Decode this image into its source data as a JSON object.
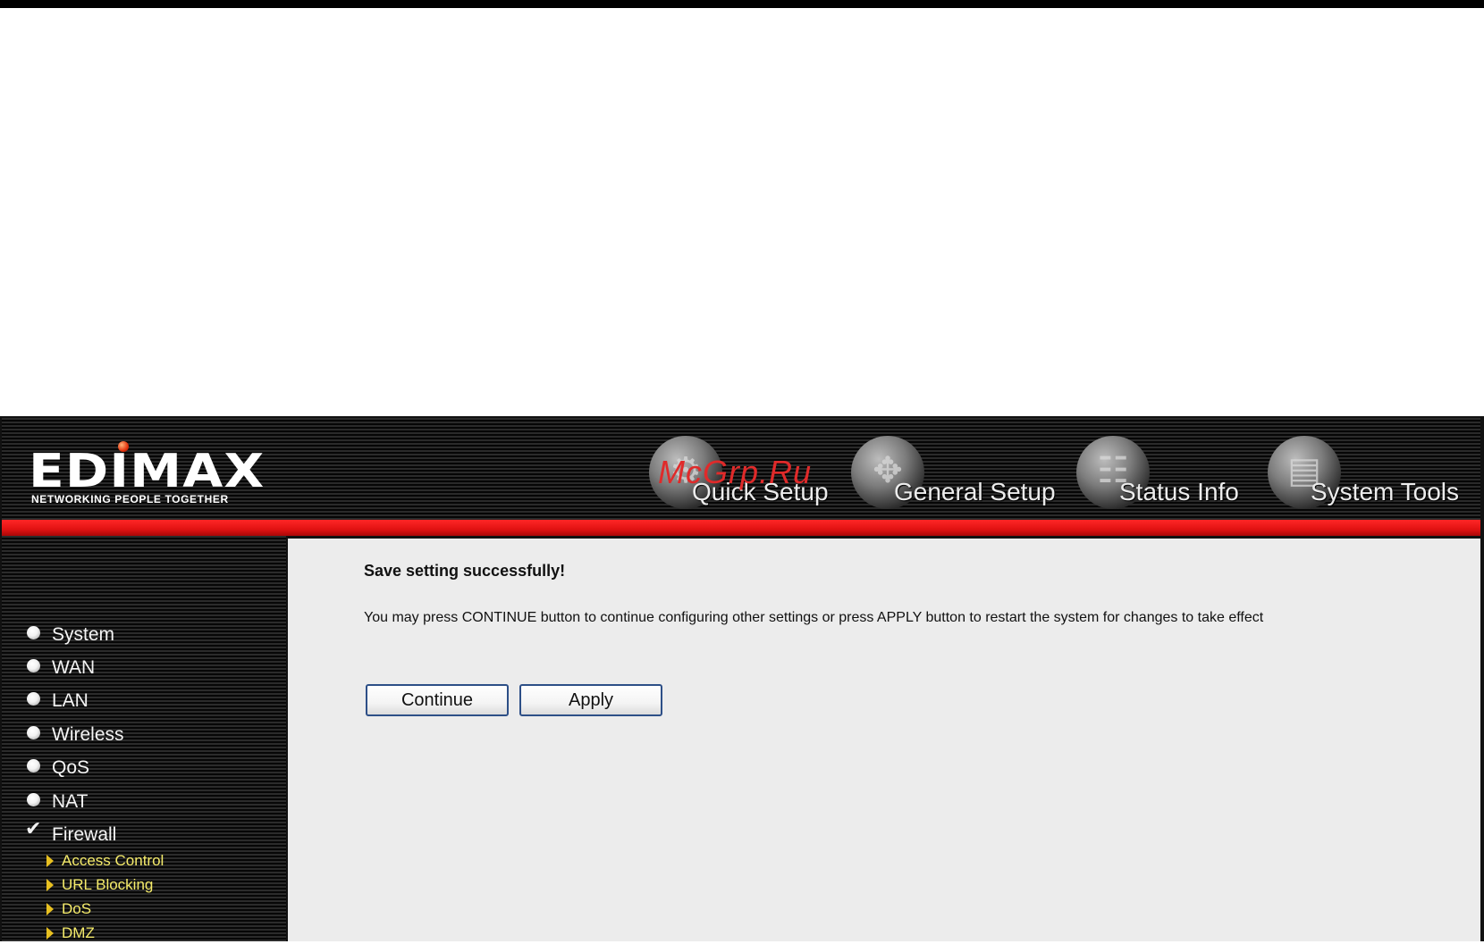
{
  "logo": {
    "brand": "EDIMAX",
    "tagline": "NETWORKING PEOPLE TOGETHER"
  },
  "watermark": "McGrp.Ru",
  "nav": [
    {
      "label": "Quick Setup",
      "icon": "quick-setup-globe"
    },
    {
      "label": "General Setup",
      "icon": "general-setup-globe"
    },
    {
      "label": "Status Info",
      "icon": "status-info-globe"
    },
    {
      "label": "System Tools",
      "icon": "system-tools-globe"
    }
  ],
  "sidebar": {
    "items": [
      {
        "label": "System",
        "state": "radio"
      },
      {
        "label": "WAN",
        "state": "radio"
      },
      {
        "label": "LAN",
        "state": "radio"
      },
      {
        "label": "Wireless",
        "state": "radio"
      },
      {
        "label": "QoS",
        "state": "radio"
      },
      {
        "label": "NAT",
        "state": "radio"
      },
      {
        "label": "Firewall",
        "state": "checked"
      }
    ],
    "firewall_sub": [
      {
        "label": "Access Control"
      },
      {
        "label": "URL Blocking"
      },
      {
        "label": "DoS"
      },
      {
        "label": "DMZ"
      }
    ]
  },
  "main": {
    "title": "Save setting successfully!",
    "message": "You may press CONTINUE button to continue configuring other settings or press APPLY button to restart the system for changes to take effect",
    "continue_label": "Continue",
    "apply_label": "Apply"
  },
  "colors": {
    "red_band": "#e01212",
    "submenu_text": "#f6ec6a",
    "button_border": "#2d4f87",
    "content_bg": "#ececec"
  }
}
